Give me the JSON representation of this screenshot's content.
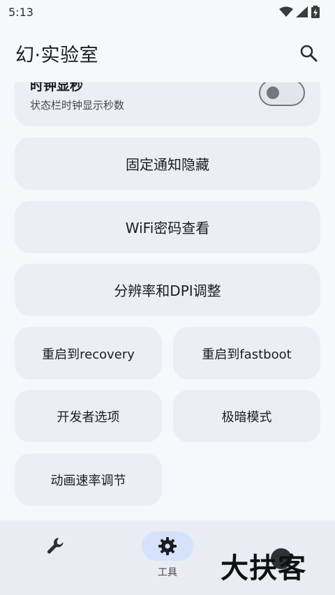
{
  "status_bar": {
    "time": "5:13"
  },
  "app_bar": {
    "title": "幻·实验室"
  },
  "toggle_setting": {
    "title": "时钟显秒",
    "subtitle": "状态栏时钟显示秒数",
    "enabled": false
  },
  "buttons": {
    "hide_notification": "固定通知隐藏",
    "wifi_password": "WiFi密码查看",
    "resolution_dpi": "分辨率和DPI调整",
    "reboot_recovery": "重启到recovery",
    "reboot_fastboot": "重启到fastboot",
    "developer_options": "开发者选项",
    "extra_dim": "极暗模式",
    "animation_speed": "动画速率调节"
  },
  "bottom_nav": {
    "tools_label": "工具"
  },
  "watermark": {
    "text": "大扶客"
  },
  "colors": {
    "accent_pill": "#d5e2fb",
    "card_bg": "#eceef5"
  }
}
